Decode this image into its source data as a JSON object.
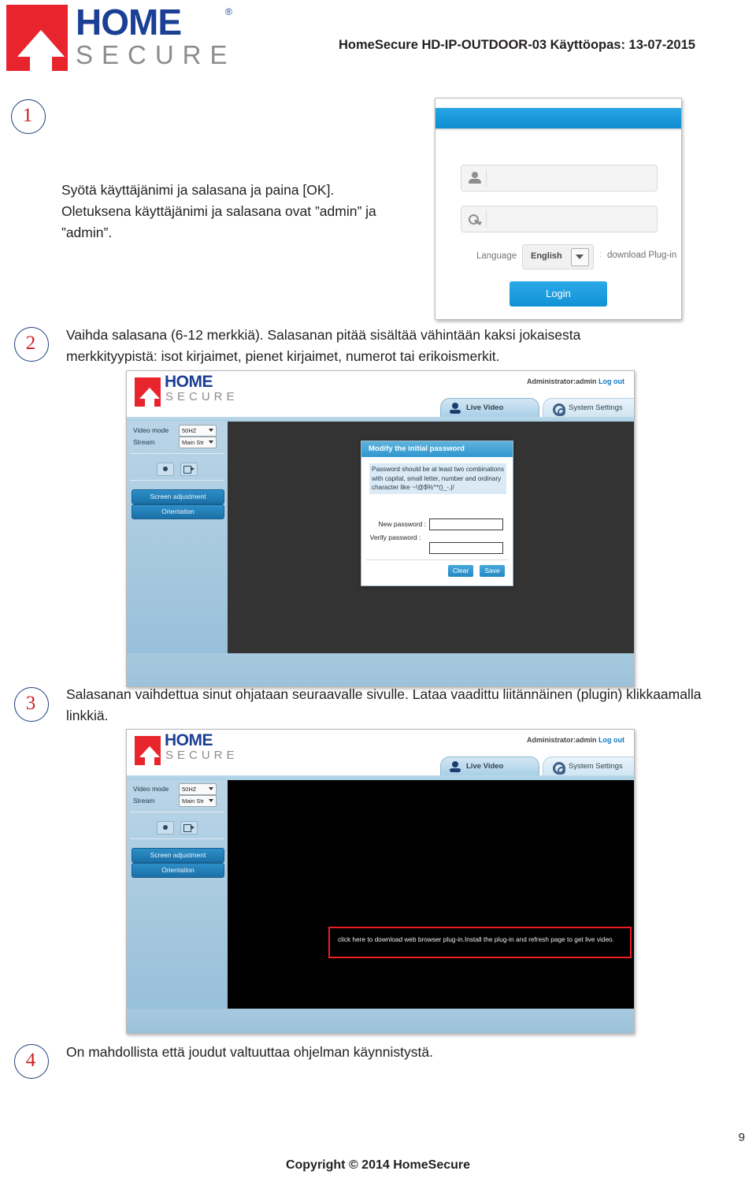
{
  "header": {
    "logo_home": "HOME",
    "logo_secure": "SECURE",
    "logo_reg": "®",
    "title": "HomeSecure HD-IP-OUTDOOR-03 Käyttöopas: 13-07-2015"
  },
  "steps": [
    {
      "number": "1",
      "text": "Syötä käyttäjänimi ja salasana ja paina [OK]. Oletuksena käyttäjänimi ja salasana ovat ”admin” ja ”admin”."
    },
    {
      "number": "2",
      "text": "Vaihda salasana (6-12 merkkiä). Salasanan pitää sisältää vähintään kaksi jokaisesta merkkityypistä: isot kirjaimet, pienet kirjaimet, numerot tai erikoismerkit."
    },
    {
      "number": "3",
      "text": "Salasanan vaihdettua sinut ohjataan seuraavalle sivulle. Lataa vaadittu liitännäinen (plugin) klikkaamalla linkkiä."
    },
    {
      "number": "4",
      "text": "On mahdollista että joudut valtuuttaa ohjelman käynnistystä."
    }
  ],
  "login_shot": {
    "username_placeholder": "",
    "password_placeholder": "",
    "language_label": "Language",
    "language_value": "English",
    "language_options": [
      "English"
    ],
    "separator": ":",
    "download_plugin": "download Plug-in",
    "login_button": "Login",
    "user_icon": "user-icon",
    "key_icon": "key-icon",
    "accent_color": "#1192d6"
  },
  "camera_ui": {
    "logo_home": "HOME",
    "logo_secure": "SECURE",
    "admin_label": "Administrator:admin",
    "logout_label": "Log out",
    "tabs": [
      {
        "label": "Live Video",
        "icon": "camera-icon",
        "active": true
      },
      {
        "label": "System Settings",
        "icon": "gear-icon",
        "active": false
      }
    ],
    "sidebar": {
      "video_mode_label": "Video mode",
      "video_mode_value": "50HZ",
      "stream_label": "Stream",
      "stream_value": "Main Str",
      "snapshot_icon": "camera-snapshot-icon",
      "record_icon": "video-record-icon",
      "buttons": [
        "Screen adjustment",
        "Orientation"
      ]
    }
  },
  "password_modal": {
    "title": "Modify the initial password",
    "hint": "Password should be at least two combinations with capital, small letter, number and ordinary character like ~!@$%^*()_-,|/",
    "new_password_label": "New password :",
    "verify_password_label": "Verify password :",
    "new_password_value": "",
    "verify_password_value": "",
    "clear_button": "Clear",
    "save_button": "Save"
  },
  "plugin_banner": {
    "text": "click here to download web browser plug-in.Install the plug-in and refresh page to get live video.",
    "border_color": "#ee1c25"
  },
  "footer": {
    "copyright": "Copyright © 2014 HomeSecure",
    "page_number": "9"
  }
}
